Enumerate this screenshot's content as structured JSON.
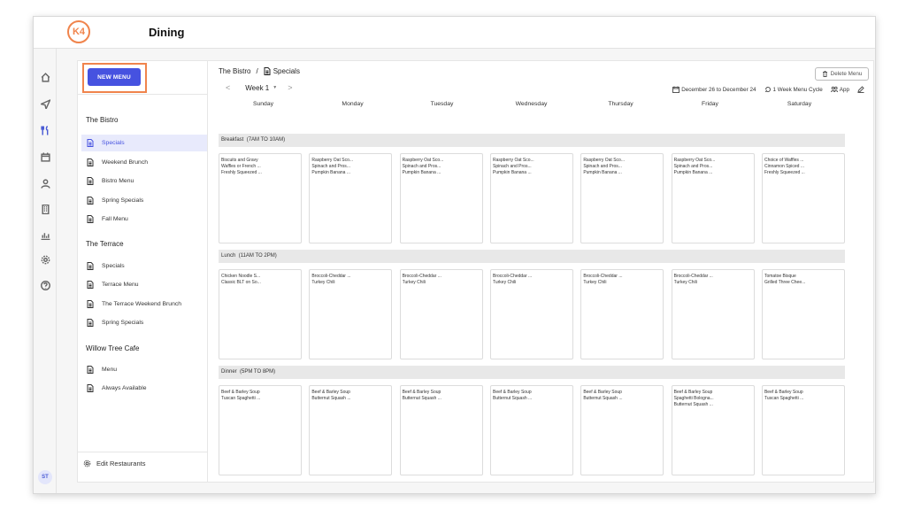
{
  "app": {
    "logo_text": "K4",
    "title": "Dining",
    "user_initials": "ST"
  },
  "sidebar_icons": [
    {
      "icon": "home-icon",
      "active": false
    },
    {
      "icon": "send-icon",
      "active": false
    },
    {
      "icon": "utensils-icon",
      "active": true
    },
    {
      "icon": "calendar-icon",
      "active": false
    },
    {
      "icon": "user-icon",
      "active": false
    },
    {
      "icon": "building-icon",
      "active": false
    },
    {
      "icon": "chart-icon",
      "active": false
    },
    {
      "icon": "gear-icon",
      "active": false
    },
    {
      "icon": "help-icon",
      "active": false
    }
  ],
  "new_menu_label": "NEW MENU",
  "restaurants": [
    {
      "name": "The Bistro",
      "menus": [
        "Specials",
        "Weekend Brunch",
        "Bistro Menu",
        "Spring Specials",
        "Fall Menu"
      ]
    },
    {
      "name": "The Terrace",
      "menus": [
        "Specials",
        "Terrace Menu",
        "The Terrace Weekend Brunch",
        "Spring Specials"
      ]
    },
    {
      "name": "Willow Tree Cafe",
      "menus": [
        "Menu",
        "Always Available"
      ]
    }
  ],
  "active_menu": "Specials",
  "edit_restaurants_label": "Edit Restaurants",
  "breadcrumb": {
    "restaurant": "The Bistro",
    "separator": "/",
    "menu": "Specials"
  },
  "delete_menu_label": "Delete Menu",
  "week": {
    "prev": "<",
    "label": "Week 1",
    "caret": "▼",
    "next": ">"
  },
  "info": {
    "date_range": "December 26 to December 24",
    "cycle": "1 Week Menu Cycle",
    "app_label": "App"
  },
  "days": [
    "Sunday",
    "Monday",
    "Tuesday",
    "Wednesday",
    "Thursday",
    "Friday",
    "Saturday"
  ],
  "meals": [
    {
      "name": "Breakfast",
      "time": "(7AM TO 10AM)",
      "cells": [
        [
          "Biscuits and Gravy",
          "Waffles or French ...",
          "Freshly Squeezed ..."
        ],
        [
          "Raspberry Oat Sco...",
          "Spinach and Pros...",
          "Pumpkin Banana ..."
        ],
        [
          "Raspberry Oat Sco...",
          "Spinach and Pros...",
          "Pumpkin Banana ..."
        ],
        [
          "Raspberry Oat Sco...",
          "Spinach and Pros...",
          "Pumpkin Banana ..."
        ],
        [
          "Raspberry Oat Sco...",
          "Spinach and Pros...",
          "Pumpkin Banana ..."
        ],
        [
          "Raspberry Oat Sco...",
          "Spinach and Pros...",
          "Pumpkin Banana ..."
        ],
        [
          "Choice of Waffles ...",
          "Cinnamon Spiced ...",
          "Freshly Squeezed ..."
        ]
      ]
    },
    {
      "name": "Lunch",
      "time": "(11AM TO 2PM)",
      "cells": [
        [
          "Chicken Noodle S...",
          "Classic BLT on So..."
        ],
        [
          "Broccoli-Cheddar ...",
          "Turkey Chili"
        ],
        [
          "Broccoli-Cheddar ...",
          "Turkey Chili"
        ],
        [
          "Broccoli-Cheddar ...",
          "Turkey Chili"
        ],
        [
          "Broccoli-Cheddar ...",
          "Turkey Chili"
        ],
        [
          "Broccoli-Cheddar ...",
          "Turkey Chili"
        ],
        [
          "Tomatoe Bisque",
          "Grilled Three Chee..."
        ]
      ]
    },
    {
      "name": "Dinner",
      "time": "(5PM TO 8PM)",
      "cells": [
        [
          "Beef & Barley Soup",
          "Tuscan Spaghetti ..."
        ],
        [
          "Beef & Barley Soup",
          "Butternut Squash ..."
        ],
        [
          "Beef & Barley Soup",
          "Butternut Squash ..."
        ],
        [
          "Beef & Barley Soup",
          "Butternut Squash ..."
        ],
        [
          "Beef & Barley Soup",
          "Butternut Squash ..."
        ],
        [
          "Beef & Barley Soup",
          "Spaghetti Bologna...",
          "Butternut Squash ..."
        ],
        [
          "Beef & Barley Soup",
          "Tuscan Spaghetti ..."
        ]
      ]
    }
  ],
  "colors": {
    "accent": "#4652e0",
    "highlight": "#f0844c",
    "active_bg": "#e8eafc"
  }
}
